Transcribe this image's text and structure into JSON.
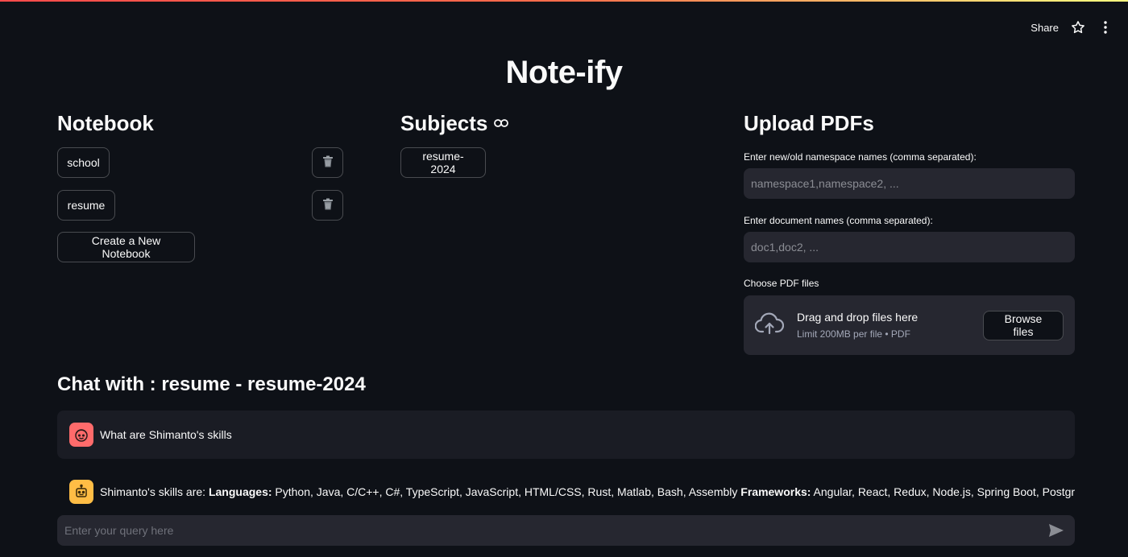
{
  "header": {
    "share_label": "Share",
    "star_icon": "star-icon",
    "menu_icon": "kebab-menu-icon"
  },
  "app_title": "Note-ify",
  "notebook": {
    "heading": "Notebook",
    "items": [
      {
        "label": "school"
      },
      {
        "label": "resume"
      }
    ],
    "create_label": "Create a New Notebook"
  },
  "subjects": {
    "heading": "Subjects",
    "items": [
      {
        "label": "resume-2024"
      }
    ]
  },
  "upload": {
    "heading": "Upload PDFs",
    "namespace_label": "Enter new/old namespace names (comma separated):",
    "namespace_placeholder": "namespace1,namespace2, ...",
    "docnames_label": "Enter document names (comma separated):",
    "docnames_placeholder": "doc1,doc2, ...",
    "files_label": "Choose PDF files",
    "drop_main": "Drag and drop files here",
    "drop_sub": "Limit 200MB per file • PDF",
    "browse_label": "Browse files"
  },
  "chat": {
    "heading": "Chat with : resume - resume-2024",
    "user_message": "What are Shimanto's skills",
    "assistant_intro": "Shimanto's skills are: ",
    "assistant_lang_label": "Languages:",
    "assistant_lang": " Python, Java, C/C++, C#, TypeScript, JavaScript, HTML/CSS, Rust, Matlab, Bash, Assembly ",
    "assistant_fw_label": "Frameworks:",
    "assistant_fw": " Angular, React, Redux, Node.js, Spring Boot, PostgreSQL,",
    "input_placeholder": "Enter your query here"
  },
  "colors": {
    "user_avatar": "#ff6b6b",
    "assistant_avatar": "#ffbd45",
    "background": "#0e1117"
  }
}
